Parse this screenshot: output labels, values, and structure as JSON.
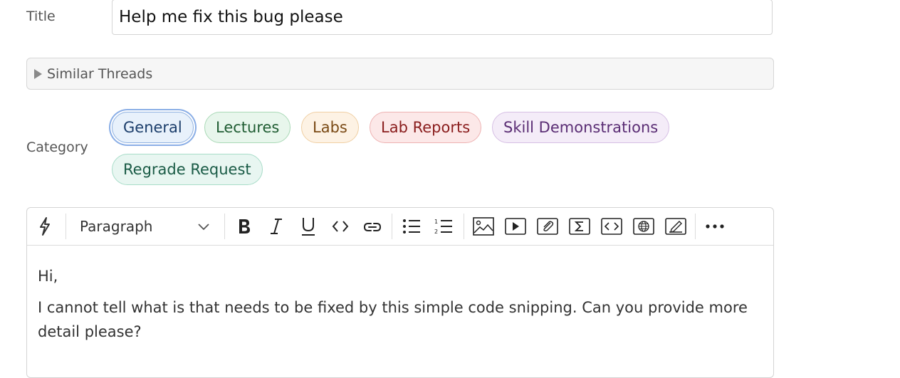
{
  "form": {
    "title_label": "Title",
    "title_value": "Help me fix this bug please",
    "similar_threads_label": "Similar Threads",
    "category_label": "Category"
  },
  "categories": [
    {
      "label": "General",
      "selected": true,
      "color": "#1c3e6b"
    },
    {
      "label": "Lectures",
      "selected": false,
      "color": "#1f5c32"
    },
    {
      "label": "Labs",
      "selected": false,
      "color": "#7a4a15"
    },
    {
      "label": "Lab Reports",
      "selected": false,
      "color": "#8a1d1d"
    },
    {
      "label": "Skill Demonstrations",
      "selected": false,
      "color": "#5a2d74"
    },
    {
      "label": "Regrade Request",
      "selected": false,
      "color": "#1a5b46"
    }
  ],
  "toolbar": {
    "paragraph_label": "Paragraph",
    "icons": [
      "quick-action-icon",
      "chevron-down-icon",
      "bold-icon",
      "italic-icon",
      "underline-icon",
      "inline-code-icon",
      "link-icon",
      "bullet-list-icon",
      "numbered-list-icon",
      "image-icon",
      "video-icon",
      "attachment-icon",
      "math-icon",
      "code-block-icon",
      "embed-web-icon",
      "drawing-icon",
      "more-icon"
    ]
  },
  "body": {
    "paragraphs": [
      "Hi,",
      "I cannot tell what is that needs to be fixed by this simple code snipping. Can you provide more detail please?"
    ]
  }
}
